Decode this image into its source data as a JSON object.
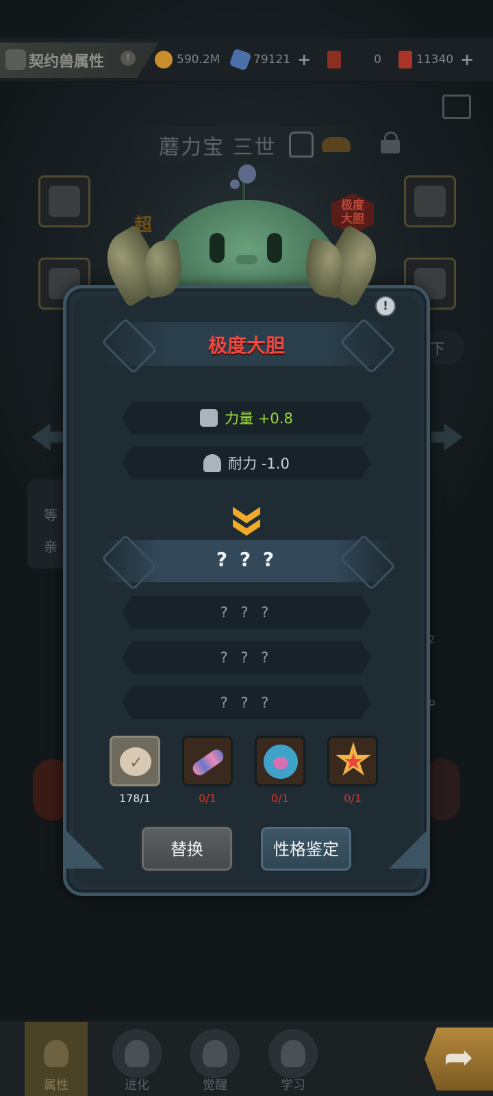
{
  "header": {
    "title": "契约兽属性",
    "info_glyph": "!",
    "resources": [
      {
        "name": "gold",
        "icon": "gold-coin-icon",
        "value": "590.2M",
        "has_plus": false,
        "color": "#c98d2e"
      },
      {
        "name": "gem",
        "icon": "blue-crystal-icon",
        "value": "79121",
        "has_plus": true,
        "color": "#4b6fa8"
      },
      {
        "name": "card-a",
        "icon": "red-card-icon",
        "value": "0",
        "has_plus": false,
        "color": "#8a2f22"
      },
      {
        "name": "card-b",
        "icon": "red-ticket-icon",
        "value": "11340",
        "has_plus": true,
        "color": "#a8342a"
      }
    ],
    "plus_glyph": "+"
  },
  "pet": {
    "name": "蘑力宝 三世",
    "badge_line1": "极度",
    "badge_line2": "大胆",
    "rank_tag": "超"
  },
  "background_fragments": {
    "left_1": "等",
    "left_2": "亲",
    "right_1": "下",
    "right_2": ".2",
    "right_3": "中"
  },
  "dialog": {
    "info_glyph": "!",
    "personality_title": "极度大胆",
    "stats": [
      {
        "icon": "fist-icon",
        "text": "力量 +0.8",
        "polarity": "positive"
      },
      {
        "icon": "shield-man-icon",
        "text": "耐力 -1.0",
        "polarity": "negative"
      }
    ],
    "result_title": "? ? ?",
    "unknown_rows": [
      "? ? ?",
      "? ? ?",
      "? ? ?"
    ],
    "items": [
      {
        "name": "bear-candy-item",
        "icon": "bear-check-icon",
        "count": "178/1",
        "selected": true,
        "sufficient": true
      },
      {
        "name": "candy-roll-item",
        "icon": "striped-candy-icon",
        "count": "0/1",
        "selected": false,
        "sufficient": false
      },
      {
        "name": "paw-jelly-item",
        "icon": "paw-jelly-icon",
        "count": "0/1",
        "selected": false,
        "sufficient": false
      },
      {
        "name": "star-cookie-item",
        "icon": "star-cookie-icon",
        "count": "0/1",
        "selected": false,
        "sufficient": false
      }
    ],
    "buttons": {
      "replace": "替换",
      "appraise": "性格鉴定"
    }
  },
  "bottom_nav": {
    "items": [
      {
        "label": "属性",
        "icon": "paw-icon",
        "active": true
      },
      {
        "label": "进化",
        "icon": "evolve-arrow-icon",
        "active": false
      },
      {
        "label": "觉醒",
        "icon": "fox-mask-icon",
        "active": false
      },
      {
        "label": "学习",
        "icon": "claw-icon",
        "active": false
      }
    ],
    "go_glyph": "➦"
  },
  "colors": {
    "positive_stat": "#9fdb3b",
    "negative_stat": "#c8d3dc",
    "title_red": "#f2473f",
    "insufficient": "#e0312a",
    "chevron": "#f0a928"
  }
}
